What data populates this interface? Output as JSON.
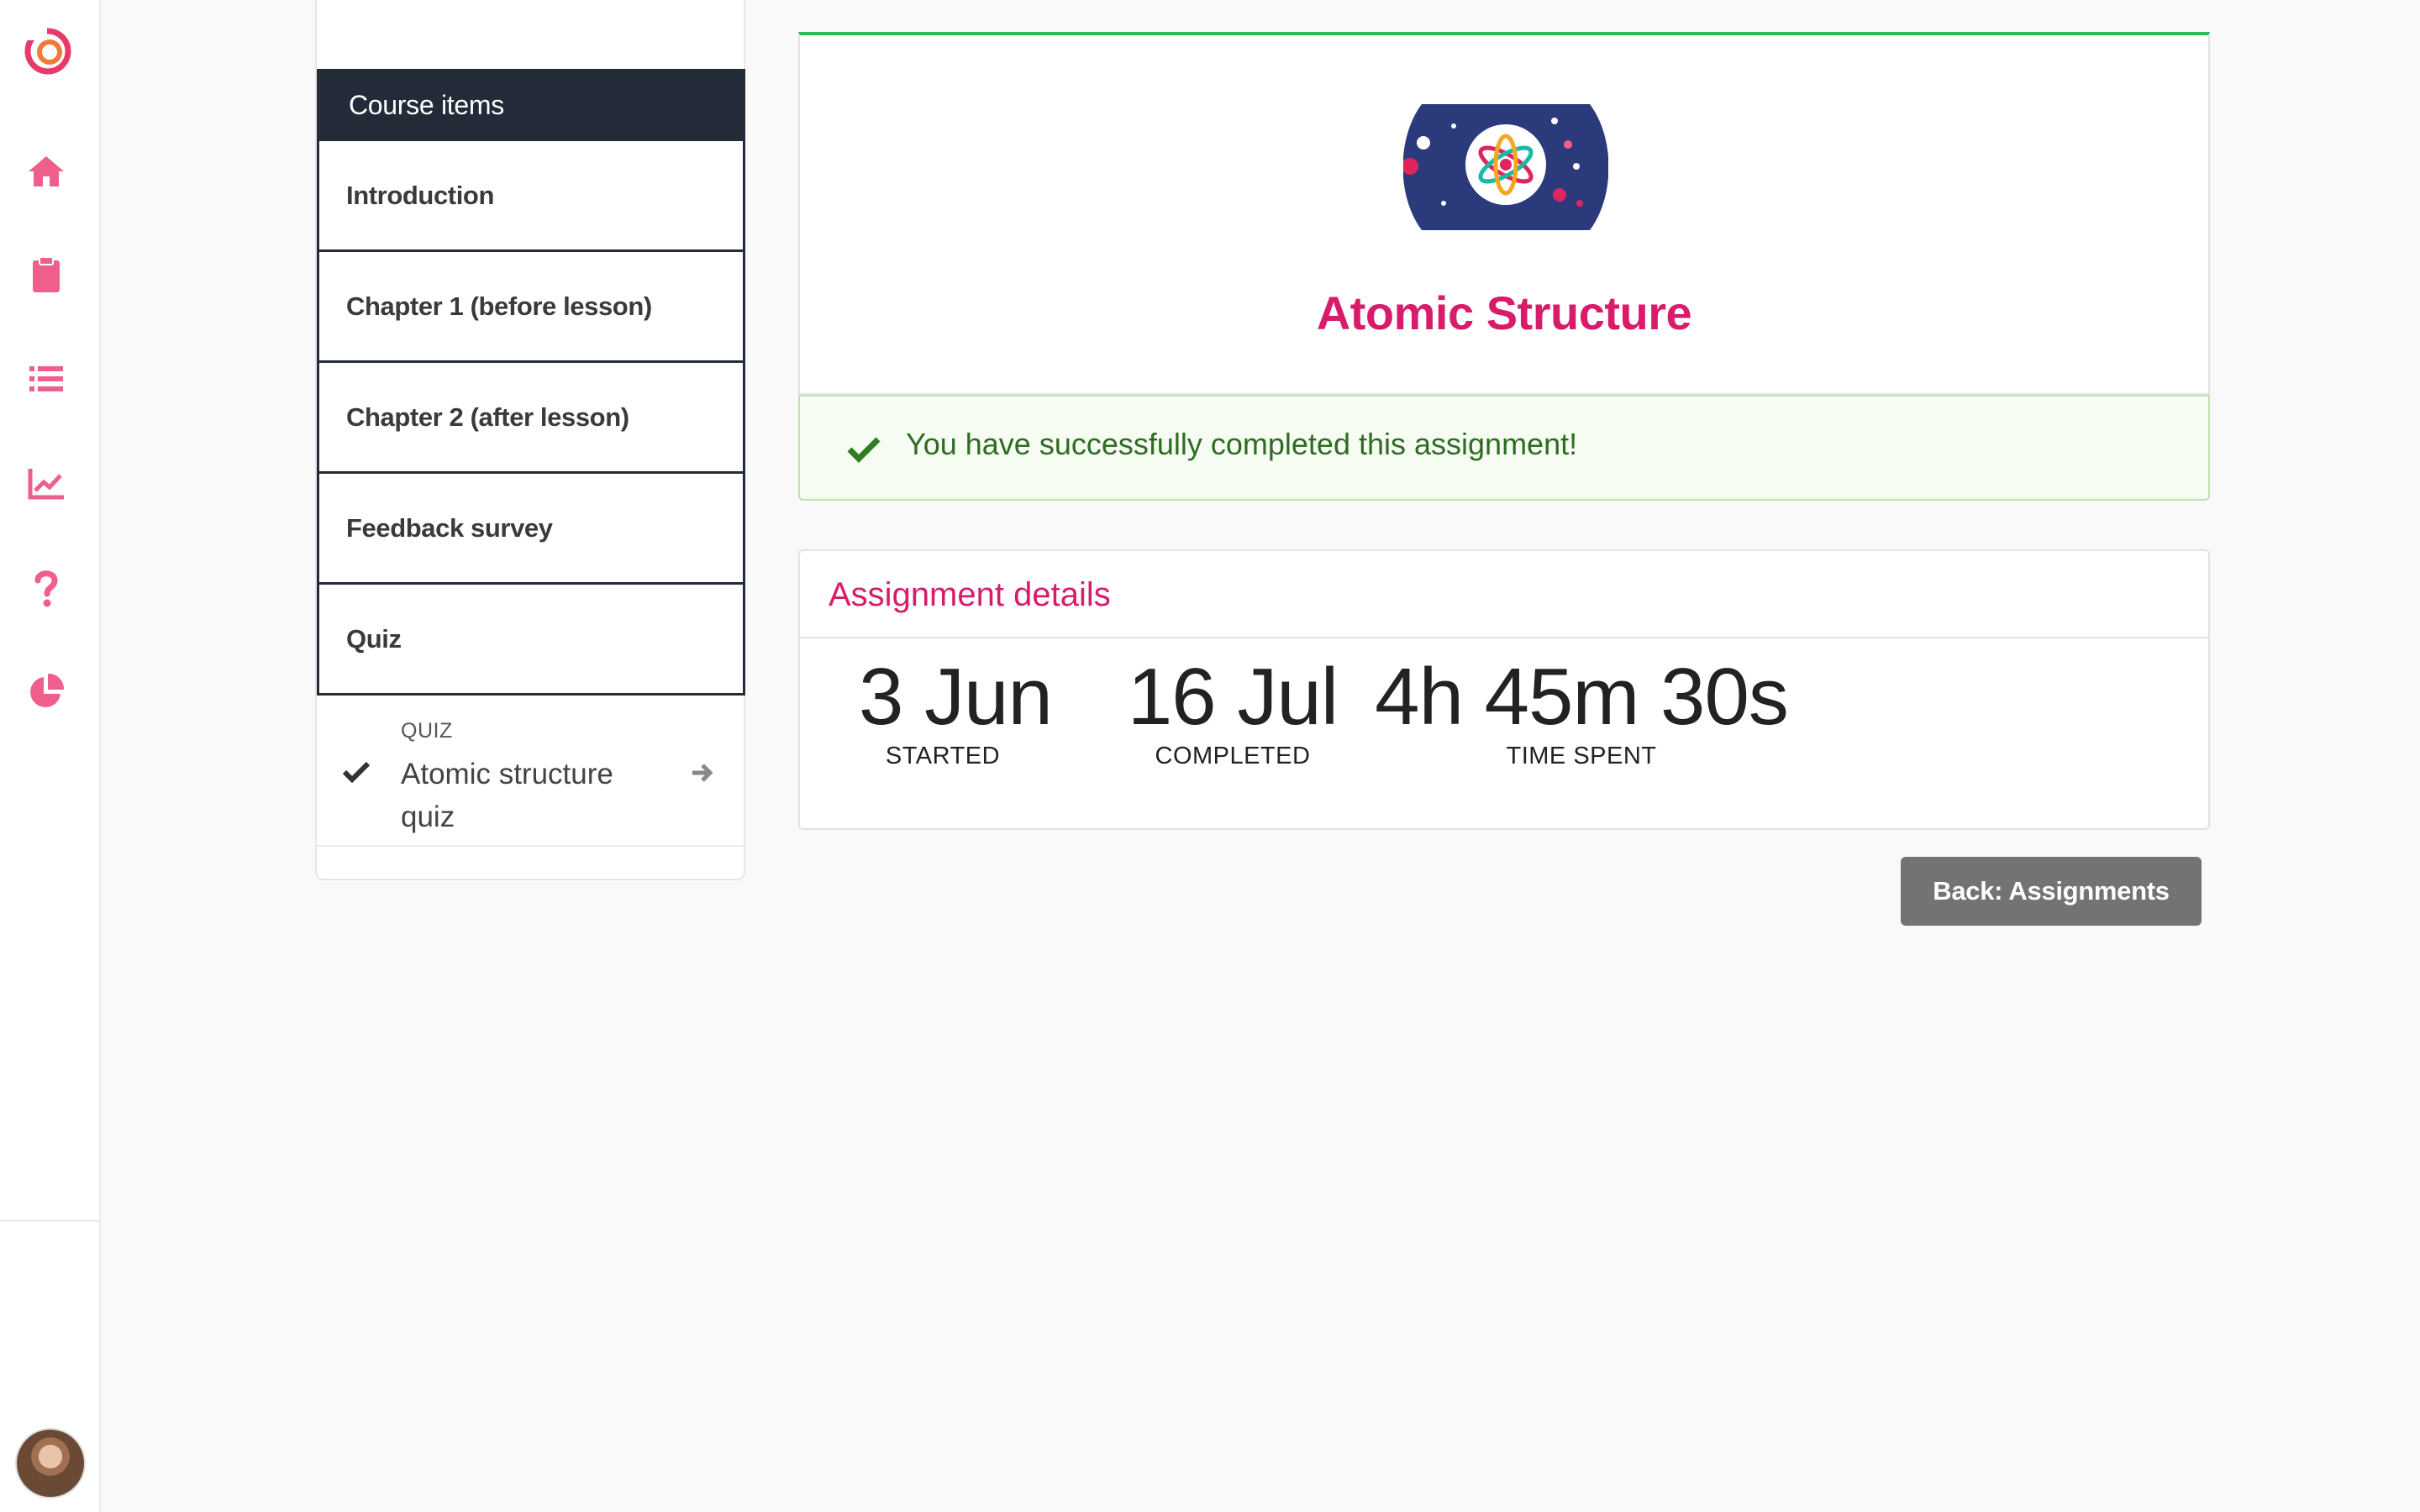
{
  "colors": {
    "brand": "#e63b6a",
    "title_pink": "#d81b6a",
    "nav_icon": "#ef5f8c",
    "header_dark": "#232b39",
    "success_green": "#2dba4e",
    "success_text": "#2e6b23"
  },
  "rail": {
    "icons": [
      "logo-icon",
      "home-icon",
      "clipboard-icon",
      "list-icon",
      "chart-line-icon",
      "question-icon",
      "pie-chart-icon"
    ]
  },
  "course": {
    "header": "Course items",
    "items": [
      {
        "label": "Introduction"
      },
      {
        "label": "Chapter 1 (before lesson)"
      },
      {
        "label": "Chapter 2 (after lesson)"
      },
      {
        "label": "Feedback survey"
      },
      {
        "label": "Quiz"
      }
    ],
    "quiz_entry": {
      "type": "QUIZ",
      "name": "Atomic structure quiz",
      "completed": true
    }
  },
  "assignment": {
    "title": "Atomic Structure",
    "success_message": "You have successfully completed this assignment!"
  },
  "details": {
    "header": "Assignment details",
    "stats": [
      {
        "value": "3 Jun",
        "label": "STARTED"
      },
      {
        "value": "16 Jul",
        "label": "COMPLETED"
      },
      {
        "value": "4h 45m 30s",
        "label": "TIME SPENT"
      }
    ]
  },
  "actions": {
    "back_label": "Back: Assignments"
  }
}
